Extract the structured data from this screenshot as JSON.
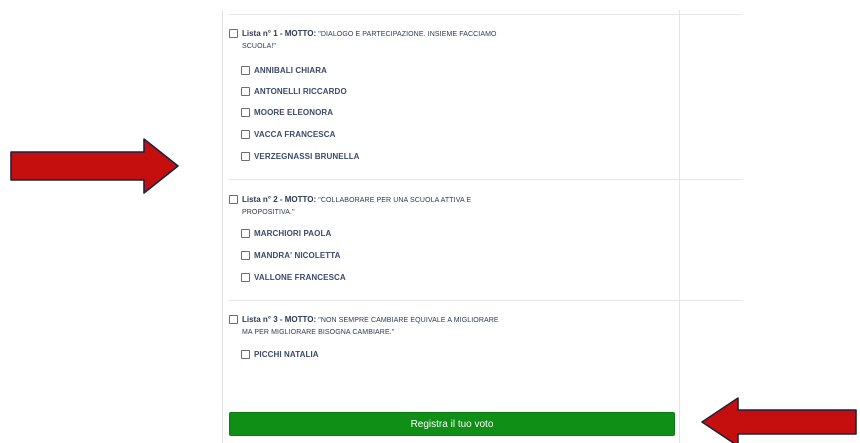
{
  "lists": [
    {
      "label": "Lista n° 1 - MOTTO:",
      "motto_line1": "\"DIALOGO E PARTECIPAZIONE. INSIEME FACCIAMO",
      "motto_line2": "SCUOLA!\"",
      "candidates": [
        "ANNIBALI CHIARA",
        "ANTONELLI RICCARDO",
        "MOORE ELEONORA",
        "VACCA FRANCESCA",
        "VERZEGNASSI BRUNELLA"
      ]
    },
    {
      "label": "Lista n° 2 - MOTTO:",
      "motto_line1": "\"COLLABORARE PER UNA SCUOLA ATTIVA E",
      "motto_line2": "PROPOSITIVA.\"",
      "candidates": [
        "MARCHIORI PAOLA",
        "MANDRA' NICOLETTA",
        "VALLONE FRANCESCA"
      ]
    },
    {
      "label": "Lista n° 3 - MOTTO:",
      "motto_line1": "\"NON SEMPRE CAMBIARE EQUIVALE A MIGLIORARE",
      "motto_line2": "MA PER MIGLIORARE BISOGNA CAMBIARE.\"",
      "candidates": [
        "PICCHI NATALIA"
      ]
    }
  ],
  "submit_label": "Registra il tuo voto",
  "colors": {
    "submit_bg": "#0f8f16",
    "arrow_fill": "#c50f0f",
    "arrow_outline": "#1d2240"
  },
  "icons": {
    "arrow_left_side": "arrow-right-icon",
    "arrow_bottom_right": "arrow-left-icon"
  }
}
